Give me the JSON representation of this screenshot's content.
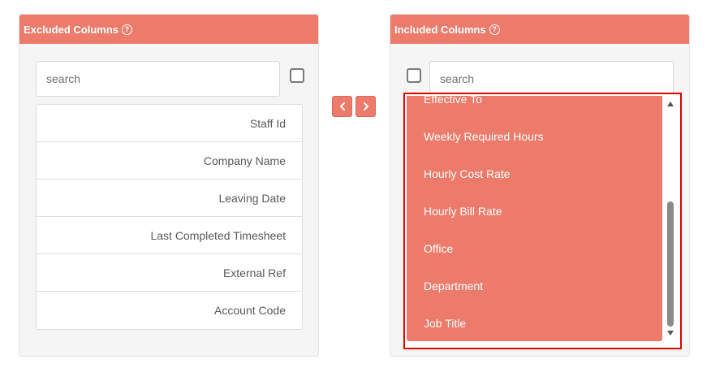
{
  "excluded": {
    "title": "Excluded Columns",
    "search_placeholder": "search",
    "items": [
      "Staff Id",
      "Company Name",
      "Leaving Date",
      "Last Completed Timesheet",
      "External Ref",
      "Account Code"
    ]
  },
  "included": {
    "title": "Included Columns",
    "search_placeholder": "search",
    "items": [
      "Effective To",
      "Weekly Required Hours",
      "Hourly Cost Rate",
      "Hourly Bill Rate",
      "Office",
      "Department",
      "Job Title"
    ]
  },
  "icons": {
    "help": "question-circle-icon",
    "move_left": "chevron-left-icon",
    "move_right": "chevron-right-icon"
  },
  "colors": {
    "accent": "#ec7b6b",
    "highlight_border": "#e00000"
  }
}
